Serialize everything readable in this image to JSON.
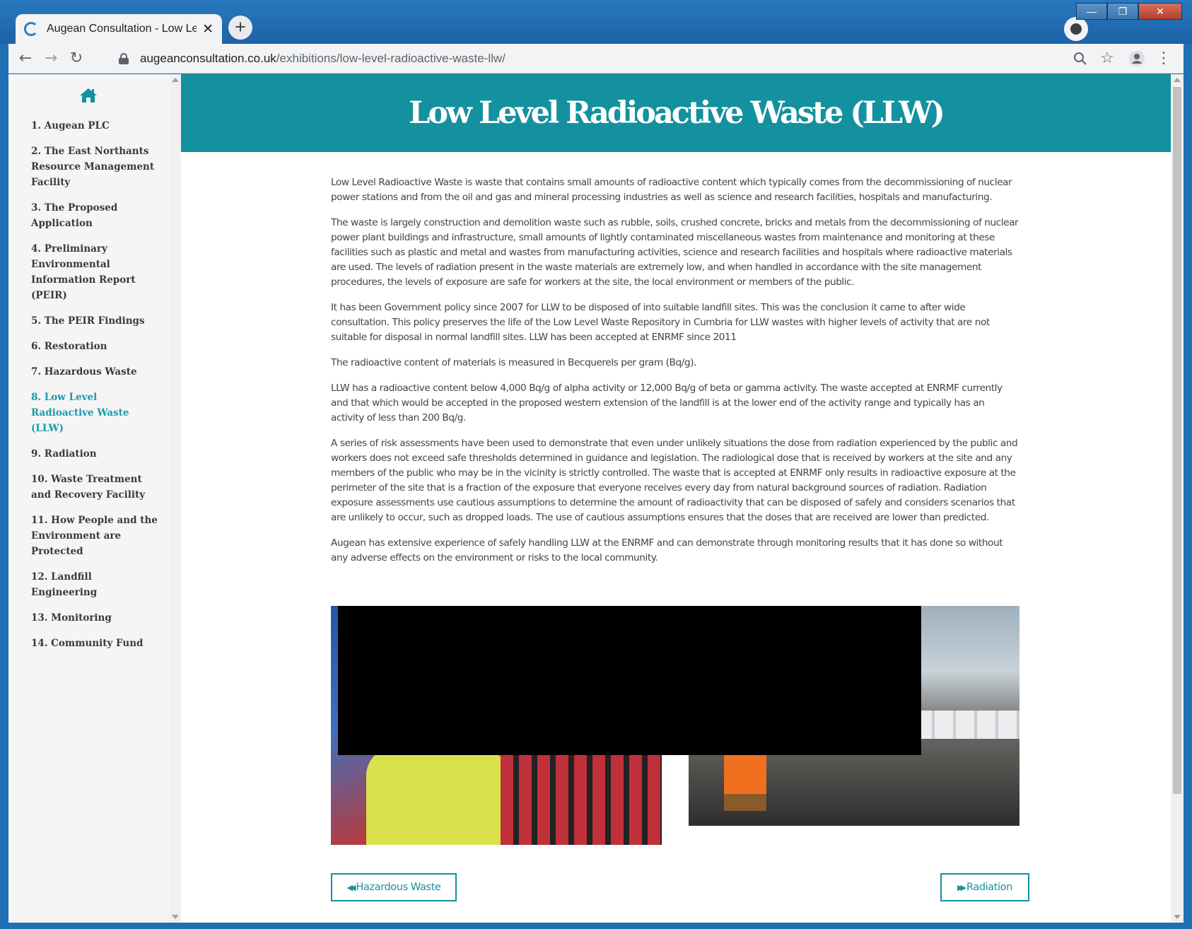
{
  "browser": {
    "tab_title": "Augean Consultation - Low Level",
    "tab_close": "✕",
    "new_tab": "+",
    "url_host": "augeanconsultation.co.uk",
    "url_path": "/exhibitions/low-level-radioactive-waste-llw/",
    "window_minimize": "—",
    "window_maximize": "❐",
    "window_close": "✕"
  },
  "sidebar": {
    "items": [
      {
        "label": "1. Augean PLC"
      },
      {
        "label": "2. The East Northants Resource Management Facility"
      },
      {
        "label": "3. The Proposed Application"
      },
      {
        "label": "4. Preliminary Environmental Information Report (PEIR)"
      },
      {
        "label": "5. The PEIR Findings"
      },
      {
        "label": "6. Restoration"
      },
      {
        "label": "7. Hazardous Waste"
      },
      {
        "label": "8. Low Level Radioactive Waste (LLW)"
      },
      {
        "label": "9. Radiation"
      },
      {
        "label": "10. Waste Treatment and Recovery Facility"
      },
      {
        "label": "11. How People and the Environment are Protected"
      },
      {
        "label": "12. Landfill Engineering"
      },
      {
        "label": "13. Monitoring"
      },
      {
        "label": "14. Community Fund"
      }
    ],
    "active_index": 7
  },
  "main": {
    "title": "Low Level Radioactive Waste (LLW)",
    "paragraphs": [
      "Low Level Radioactive Waste is waste that contains small amounts of radioactive content which typically comes from the decommissioning of nuclear power stations and from the oil and gas and mineral processing industries as well as science and research facilities, hospitals and manufacturing.",
      "The waste is largely construction and demolition waste such as rubble, soils, crushed concrete, bricks and metals from the decommissioning of nuclear power plant buildings and infrastructure, small amounts of lightly contaminated miscellaneous wastes from maintenance and monitoring at these facilities such as plastic and metal and wastes from manufacturing activities, science and research facilities and hospitals where radioactive materials are used. The levels of radiation present in the waste materials are extremely low, and when handled in accordance with the site management procedures, the levels of exposure are safe for workers at the site, the local environment or members of the public.",
      "It has been Government policy since 2007 for LLW to be disposed of into suitable landfill sites. This was the conclusion it came to after wide consultation. This policy preserves the life of the Low Level Waste Repository in Cumbria for LLW wastes with higher levels of activity that are not suitable for disposal in normal landfill sites. LLW has been accepted at ENRMF since 2011",
      "The radioactive content of materials is measured in Becquerels per gram (Bq/g).",
      "LLW has a radioactive content below 4,000 Bq/g of alpha activity or 12,000 Bq/g of beta or gamma activity. The waste accepted at ENRMF currently and that which would be accepted in the proposed western extension of the landfill is at the lower end of the activity range and typically has an activity of less than 200 Bq/g.",
      "A series of risk assessments have been used to demonstrate that even under unlikely situations the dose from radiation experienced by the public and workers does not exceed safe thresholds determined in guidance and legislation. The radiological dose that is received by workers at the site and any members of the public who may be in the vicinity is strictly controlled. The waste that is accepted at ENRMF only results in radioactive exposure at the perimeter of the site that is a fraction of the exposure that everyone receives every day from natural background sources of radiation. Radiation exposure assessments use cautious assumptions to determine the amount of radioactivity that can be disposed of safely and considers scenarios that are unlikely to occur, such as dropped loads. The use of cautious assumptions ensures that the doses that are received are lower than predicted.",
      "Augean has extensive experience of safely handling LLW at the ENRMF and can demonstrate through monitoring results that it has done so without any adverse effects on the environment or risks to the local community."
    ],
    "prev_label": "Hazardous Waste",
    "next_label": "Radiation"
  },
  "colors": {
    "accent": "#14919e",
    "active_nav": "#1a9aa8",
    "body_text": "#444444"
  },
  "icons": [
    "home-icon",
    "back-arrow-icon",
    "forward-arrow-icon",
    "reload-icon",
    "lock-icon",
    "zoom-icon",
    "star-icon",
    "account-icon",
    "menu-dots-icon",
    "rewind-icon",
    "fast-forward-icon"
  ]
}
